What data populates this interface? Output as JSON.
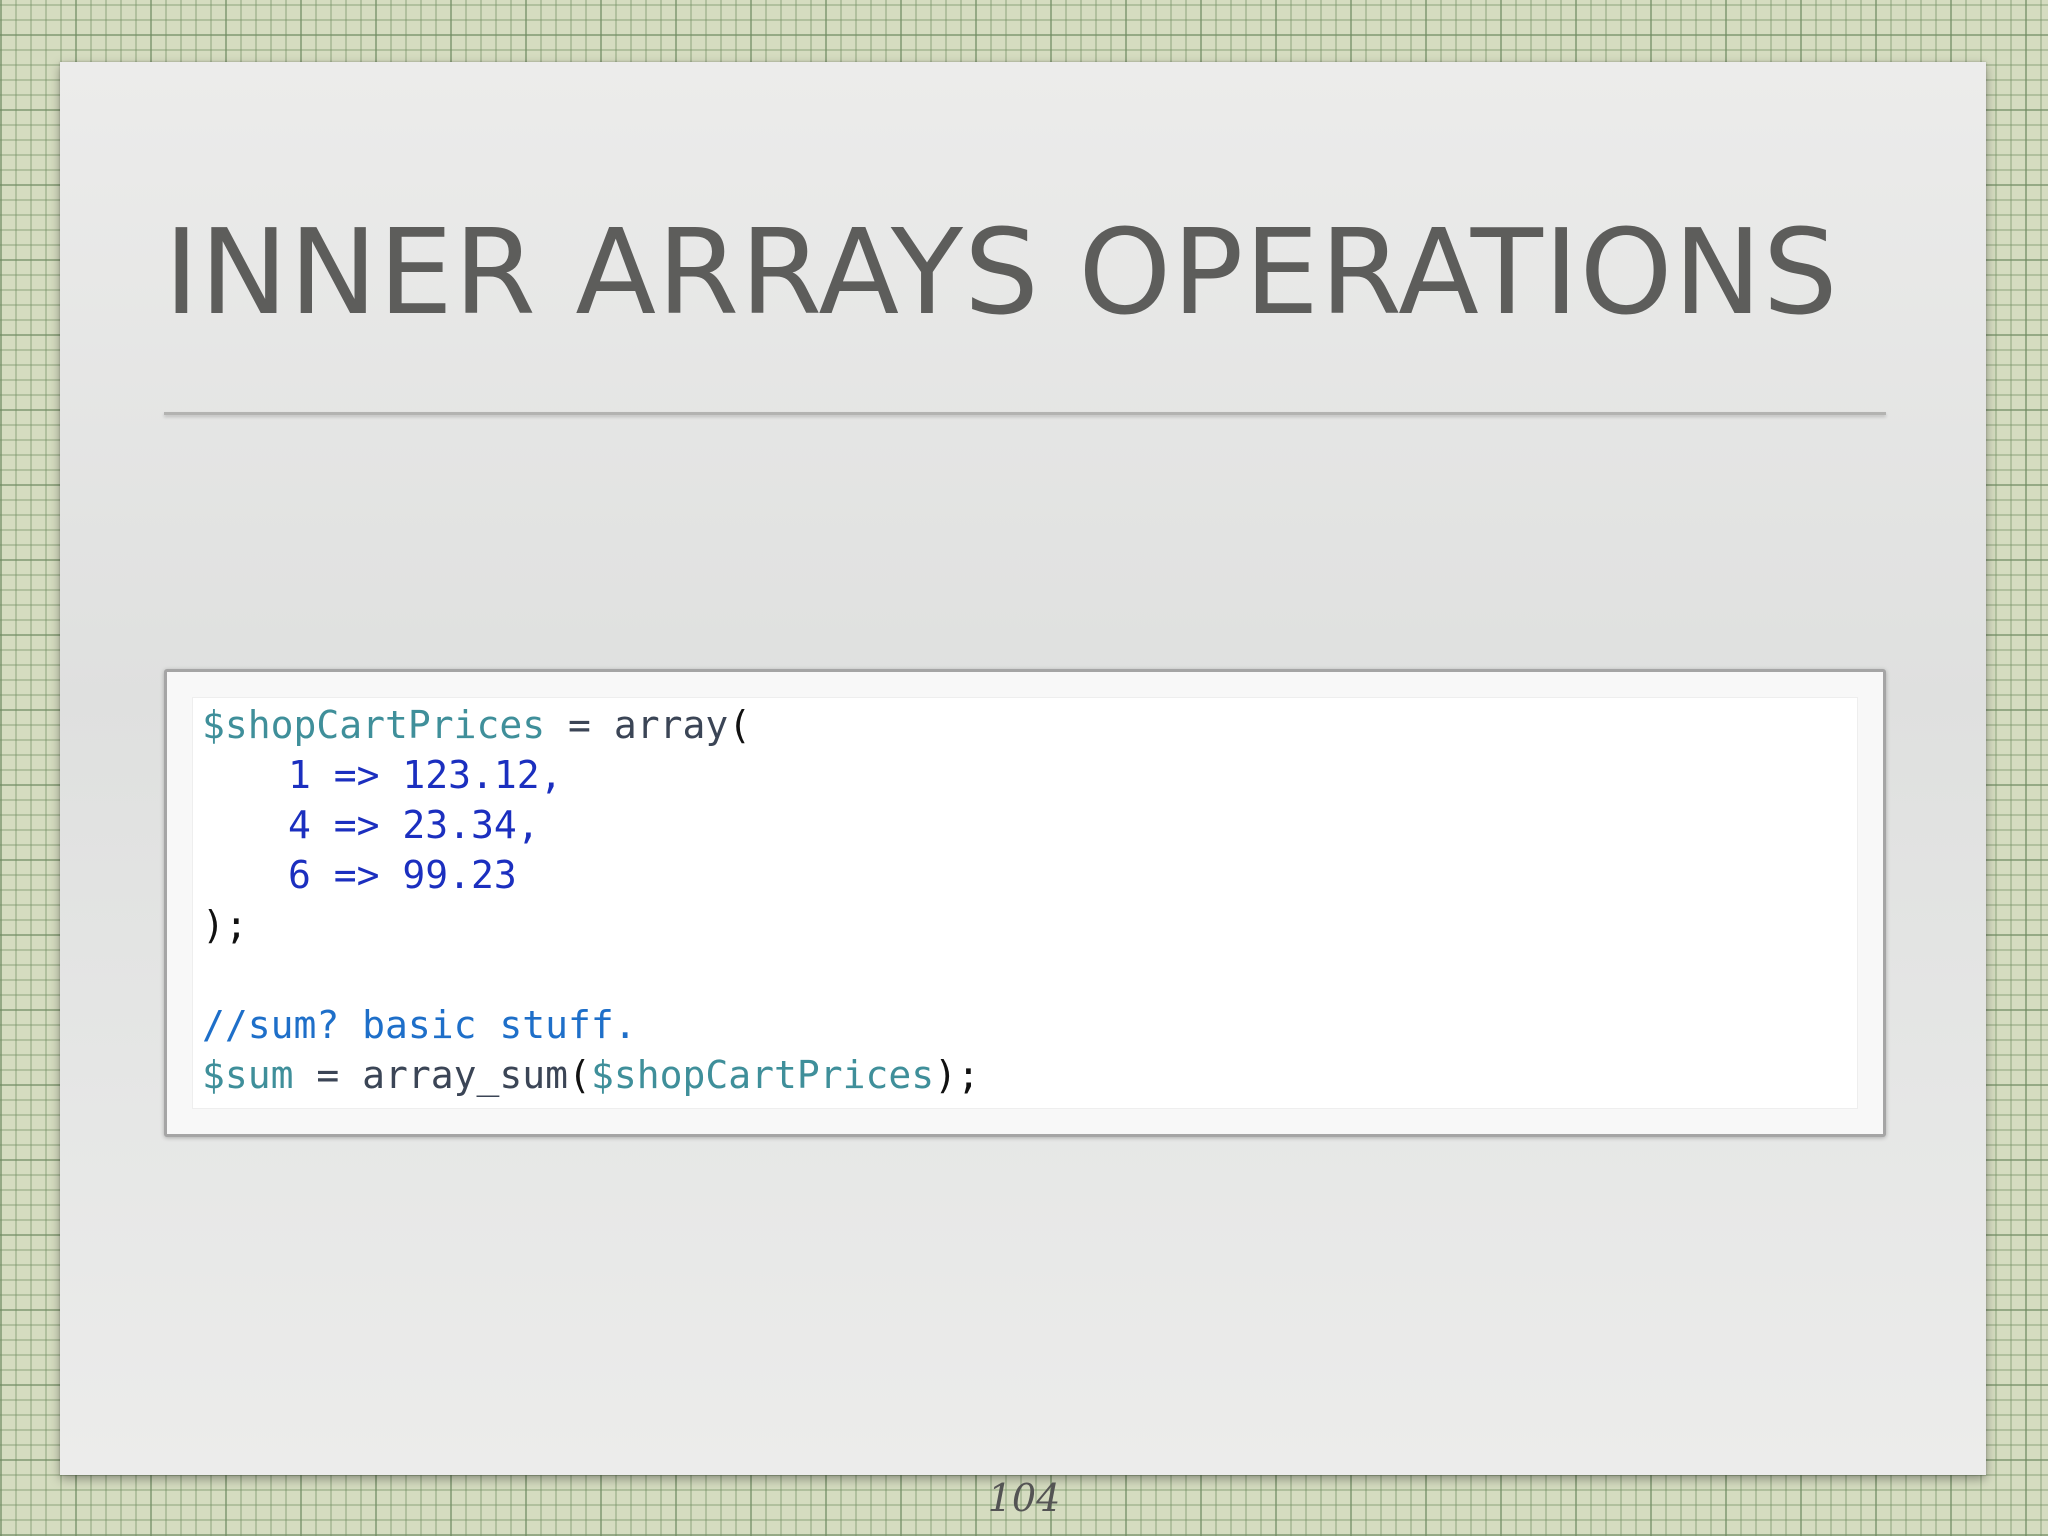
{
  "slide": {
    "title": "INNER ARRAYS OPERATIONS",
    "page_number": "104"
  },
  "code": {
    "line1": {
      "var": "$shopCartPrices",
      "op": " = ",
      "fn": "array",
      "punct": "("
    },
    "line2": {
      "text": "1 => 123.12,"
    },
    "line3": {
      "text": "4 => 23.34,"
    },
    "line4": {
      "text": "6 => 99.23"
    },
    "line5": {
      "punct": ");"
    },
    "line7": {
      "comment": "//sum? basic stuff."
    },
    "line8": {
      "var": "$sum",
      "op": " = ",
      "fn": "array_sum",
      "open": "(",
      "arg": "$shopCartPrices",
      "close": ");"
    }
  },
  "colors": {
    "variable": "#3f8f9a",
    "function": "#3b4556",
    "number": "#1b2fbf",
    "comment": "#1e6fc9",
    "title": "#5d5d5b"
  }
}
